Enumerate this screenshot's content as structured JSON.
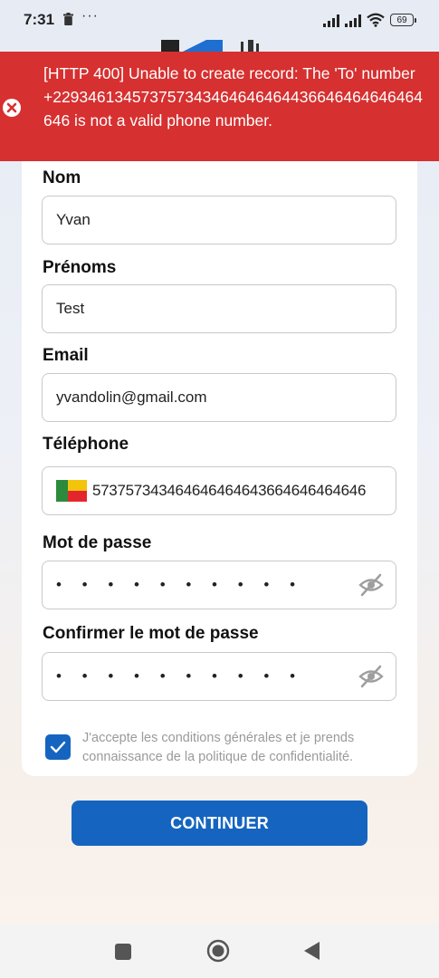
{
  "status_bar": {
    "time": "7:31",
    "more": "···",
    "battery": "69"
  },
  "error_banner": {
    "message": "[HTTP 400] Unable to create record: The 'To' number +229346134573757343464646464436646464646464646 is not a valid phone number."
  },
  "form": {
    "nom": {
      "label": "Nom",
      "value": "Yvan"
    },
    "prenoms": {
      "label": "Prénoms",
      "value": "Test"
    },
    "email": {
      "label": "Email",
      "value": "yvandolin@gmail.com"
    },
    "telephone": {
      "label": "Téléphone",
      "value": "573757343464646464643664646464646",
      "country": "Benin"
    },
    "mot_de_passe": {
      "label": "Mot de passe",
      "value": "• • • • • • • • • •"
    },
    "confirmer": {
      "label": "Confirmer le mot de passe",
      "value": "• • • • • • • • • •"
    },
    "terms": {
      "text": "J'accepte les conditions générales et je prends connaissance de la politique de confidentialité.",
      "checked": true
    },
    "submit_label": "CONTINUER"
  },
  "colors": {
    "error": "#d63030",
    "primary": "#1565c0"
  },
  "icons": [
    "trash-icon",
    "signal-icon",
    "wifi-icon",
    "battery-icon",
    "error-circle-icon",
    "eye-off-icon",
    "check-icon",
    "nav-recents-icon",
    "nav-home-icon",
    "nav-back-icon"
  ]
}
